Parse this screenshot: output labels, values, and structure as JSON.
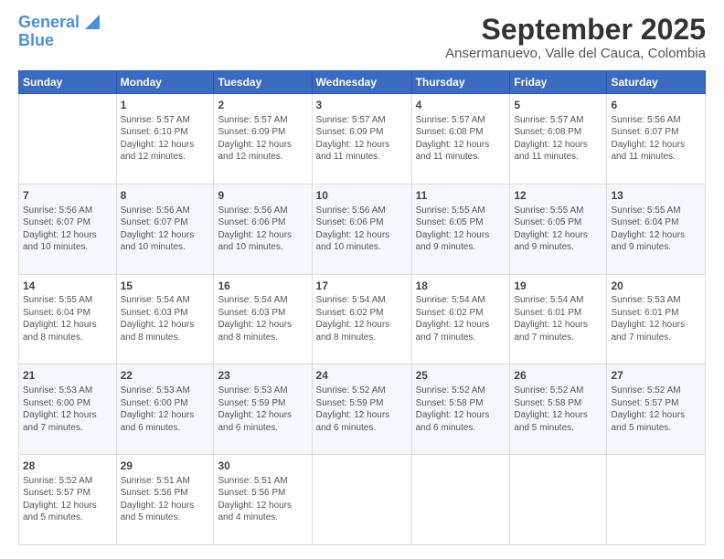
{
  "logo": {
    "line1": "General",
    "line2": "Blue"
  },
  "title": "September 2025",
  "subtitle": "Ansermanuevo, Valle del Cauca, Colombia",
  "weekdays": [
    "Sunday",
    "Monday",
    "Tuesday",
    "Wednesday",
    "Thursday",
    "Friday",
    "Saturday"
  ],
  "weeks": [
    [
      {
        "day": "",
        "text": ""
      },
      {
        "day": "1",
        "text": "Sunrise: 5:57 AM\nSunset: 6:10 PM\nDaylight: 12 hours\nand 12 minutes."
      },
      {
        "day": "2",
        "text": "Sunrise: 5:57 AM\nSunset: 6:09 PM\nDaylight: 12 hours\nand 12 minutes."
      },
      {
        "day": "3",
        "text": "Sunrise: 5:57 AM\nSunset: 6:09 PM\nDaylight: 12 hours\nand 11 minutes."
      },
      {
        "day": "4",
        "text": "Sunrise: 5:57 AM\nSunset: 6:08 PM\nDaylight: 12 hours\nand 11 minutes."
      },
      {
        "day": "5",
        "text": "Sunrise: 5:57 AM\nSunset: 6:08 PM\nDaylight: 12 hours\nand 11 minutes."
      },
      {
        "day": "6",
        "text": "Sunrise: 5:56 AM\nSunset: 6:07 PM\nDaylight: 12 hours\nand 11 minutes."
      }
    ],
    [
      {
        "day": "7",
        "text": "Sunrise: 5:56 AM\nSunset: 6:07 PM\nDaylight: 12 hours\nand 10 minutes."
      },
      {
        "day": "8",
        "text": "Sunrise: 5:56 AM\nSunset: 6:07 PM\nDaylight: 12 hours\nand 10 minutes."
      },
      {
        "day": "9",
        "text": "Sunrise: 5:56 AM\nSunset: 6:06 PM\nDaylight: 12 hours\nand 10 minutes."
      },
      {
        "day": "10",
        "text": "Sunrise: 5:56 AM\nSunset: 6:06 PM\nDaylight: 12 hours\nand 10 minutes."
      },
      {
        "day": "11",
        "text": "Sunrise: 5:55 AM\nSunset: 6:05 PM\nDaylight: 12 hours\nand 9 minutes."
      },
      {
        "day": "12",
        "text": "Sunrise: 5:55 AM\nSunset: 6:05 PM\nDaylight: 12 hours\nand 9 minutes."
      },
      {
        "day": "13",
        "text": "Sunrise: 5:55 AM\nSunset: 6:04 PM\nDaylight: 12 hours\nand 9 minutes."
      }
    ],
    [
      {
        "day": "14",
        "text": "Sunrise: 5:55 AM\nSunset: 6:04 PM\nDaylight: 12 hours\nand 8 minutes."
      },
      {
        "day": "15",
        "text": "Sunrise: 5:54 AM\nSunset: 6:03 PM\nDaylight: 12 hours\nand 8 minutes."
      },
      {
        "day": "16",
        "text": "Sunrise: 5:54 AM\nSunset: 6:03 PM\nDaylight: 12 hours\nand 8 minutes."
      },
      {
        "day": "17",
        "text": "Sunrise: 5:54 AM\nSunset: 6:02 PM\nDaylight: 12 hours\nand 8 minutes."
      },
      {
        "day": "18",
        "text": "Sunrise: 5:54 AM\nSunset: 6:02 PM\nDaylight: 12 hours\nand 7 minutes."
      },
      {
        "day": "19",
        "text": "Sunrise: 5:54 AM\nSunset: 6:01 PM\nDaylight: 12 hours\nand 7 minutes."
      },
      {
        "day": "20",
        "text": "Sunrise: 5:53 AM\nSunset: 6:01 PM\nDaylight: 12 hours\nand 7 minutes."
      }
    ],
    [
      {
        "day": "21",
        "text": "Sunrise: 5:53 AM\nSunset: 6:00 PM\nDaylight: 12 hours\nand 7 minutes."
      },
      {
        "day": "22",
        "text": "Sunrise: 5:53 AM\nSunset: 6:00 PM\nDaylight: 12 hours\nand 6 minutes."
      },
      {
        "day": "23",
        "text": "Sunrise: 5:53 AM\nSunset: 5:59 PM\nDaylight: 12 hours\nand 6 minutes."
      },
      {
        "day": "24",
        "text": "Sunrise: 5:52 AM\nSunset: 5:59 PM\nDaylight: 12 hours\nand 6 minutes."
      },
      {
        "day": "25",
        "text": "Sunrise: 5:52 AM\nSunset: 5:58 PM\nDaylight: 12 hours\nand 6 minutes."
      },
      {
        "day": "26",
        "text": "Sunrise: 5:52 AM\nSunset: 5:58 PM\nDaylight: 12 hours\nand 5 minutes."
      },
      {
        "day": "27",
        "text": "Sunrise: 5:52 AM\nSunset: 5:57 PM\nDaylight: 12 hours\nand 5 minutes."
      }
    ],
    [
      {
        "day": "28",
        "text": "Sunrise: 5:52 AM\nSunset: 5:57 PM\nDaylight: 12 hours\nand 5 minutes."
      },
      {
        "day": "29",
        "text": "Sunrise: 5:51 AM\nSunset: 5:56 PM\nDaylight: 12 hours\nand 5 minutes."
      },
      {
        "day": "30",
        "text": "Sunrise: 5:51 AM\nSunset: 5:56 PM\nDaylight: 12 hours\nand 4 minutes."
      },
      {
        "day": "",
        "text": ""
      },
      {
        "day": "",
        "text": ""
      },
      {
        "day": "",
        "text": ""
      },
      {
        "day": "",
        "text": ""
      }
    ]
  ]
}
